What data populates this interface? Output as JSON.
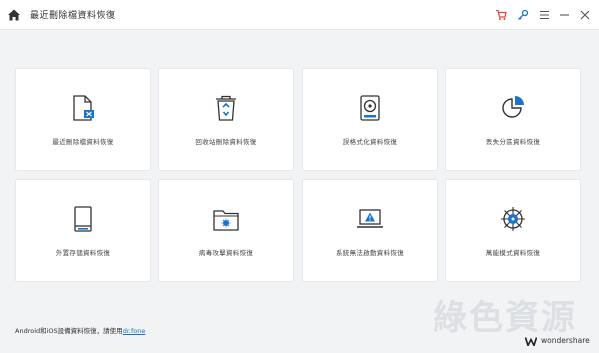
{
  "window": {
    "title": "最近刪除檔資料恢復",
    "accent_color": "#1a73c9",
    "cart_color": "#e8453c"
  },
  "toolbar": {
    "home_icon": "home-icon",
    "cart_icon": "cart-icon",
    "key_icon": "key-icon",
    "menu_icon": "menu-icon",
    "minimize_icon": "minimize-icon",
    "close_icon": "close-icon"
  },
  "cards": [
    {
      "label": "最近刪除檔資料恢復",
      "icon": "deleted-file-icon"
    },
    {
      "label": "回收站刪除資料恢復",
      "icon": "recycle-bin-icon"
    },
    {
      "label": "誤格式化資料恢復",
      "icon": "hard-drive-icon"
    },
    {
      "label": "丟失分區資料恢復",
      "icon": "partition-pie-icon"
    },
    {
      "label": "外置存儲資料恢復",
      "icon": "external-storage-icon"
    },
    {
      "label": "病毒攻擊資料恢復",
      "icon": "virus-folder-icon"
    },
    {
      "label": "系統無法啟動資料恢復",
      "icon": "system-warning-icon"
    },
    {
      "label": "萬能模式資料恢復",
      "icon": "all-round-icon"
    }
  ],
  "footer": {
    "text": "Android和iOS設備資料恢復，請使用",
    "link": "dr.fone"
  },
  "brand": {
    "name": "wondershare"
  },
  "watermark": {
    "text": "綠色資源"
  }
}
